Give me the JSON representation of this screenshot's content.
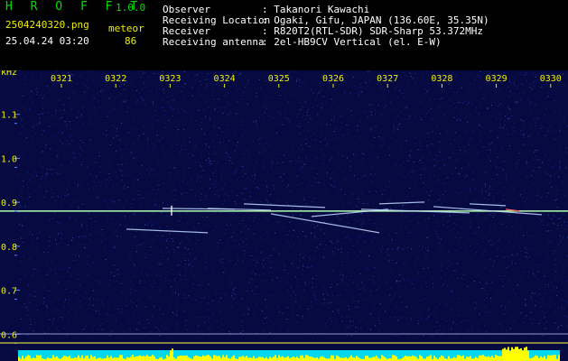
{
  "header": {
    "app_name": "H R O F F T",
    "version": "1.0.0",
    "file_name": "2504240320.png",
    "date_time": "25.04.24 03:20",
    "meteor_label": "meteor",
    "meteor_count": "86",
    "info": [
      {
        "label": "Observer",
        "value": ": Takanori Kawachi"
      },
      {
        "label": "Receiving Location",
        "value": ": Ogaki, Gifu, JAPAN (136.60E, 35.35N)"
      },
      {
        "label": "Receiver",
        "value": ": R820T2(RTL-SDR) SDR-Sharp 53.372MHz"
      },
      {
        "label": "Receiving antenna",
        "value": ": 2el-HB9CV Vertical (el. E-W)"
      }
    ]
  },
  "chart_data": {
    "type": "heatmap",
    "y_unit_label": "kHz",
    "x_ticks": [
      "0321",
      "0322",
      "0323",
      "0324",
      "0325",
      "0326",
      "0327",
      "0328",
      "0329",
      "0330"
    ],
    "y_ticks": [
      "1.1",
      "1.0",
      "0.9",
      "0.8",
      "0.7",
      "0.6"
    ],
    "ylim": [
      0.58,
      1.2
    ],
    "carrier_khz": 0.88,
    "colors": {
      "background": "#060a40",
      "noise": "#2840c0",
      "signal": "#c0d8ff",
      "carrier": "#b0ffb0",
      "grid": "#6080ff",
      "axis_text": "#f0f000",
      "baseline": "#ffff40",
      "activity_low": "#00d8f0",
      "activity_high": "#ffff00"
    }
  }
}
